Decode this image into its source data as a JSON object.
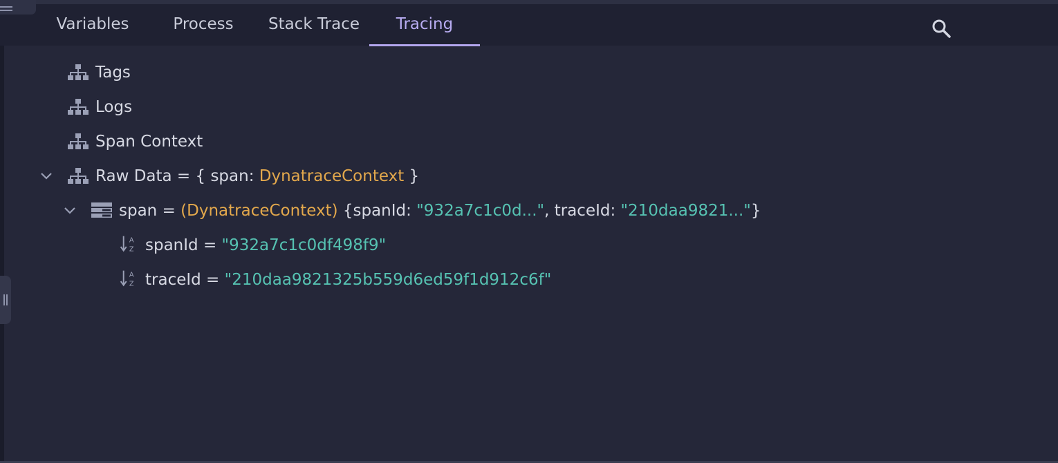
{
  "tabs": [
    {
      "label": "Variables"
    },
    {
      "label": "Process"
    },
    {
      "label": "Stack Trace"
    },
    {
      "label": "Tracing"
    }
  ],
  "icons": {
    "search": "search-icon",
    "tree": "hierarchy-icon",
    "object": "object-structure-icon",
    "field": "sort-az-icon",
    "chevron": "chevron-down-icon",
    "menu": "menu-icon"
  },
  "colors": {
    "active_tab": "#b8acf2",
    "type_name": "#e3a84c",
    "string_value": "#56c2b2"
  },
  "tree": {
    "tags": {
      "label": "Tags"
    },
    "logs": {
      "label": "Logs"
    },
    "span_context": {
      "label": "Span Context"
    },
    "raw_data": {
      "label": "Raw Data = { span: ",
      "type": "DynatraceContext",
      "close": " }"
    },
    "span": {
      "name": "span = ",
      "type": "(DynatraceContext)",
      "summary_open": " {spanId: ",
      "span_preview": "\"932a7c1c0d...\"",
      "sep": ", traceId: ",
      "trace_preview": "\"210daa9821...\"",
      "summary_close": "}"
    },
    "span_id": {
      "name": "spanId = ",
      "value": "\"932a7c1c0df498f9\""
    },
    "trace_id": {
      "name": "traceId = ",
      "value": "\"210daa9821325b559d6ed59f1d912c6f\""
    }
  }
}
